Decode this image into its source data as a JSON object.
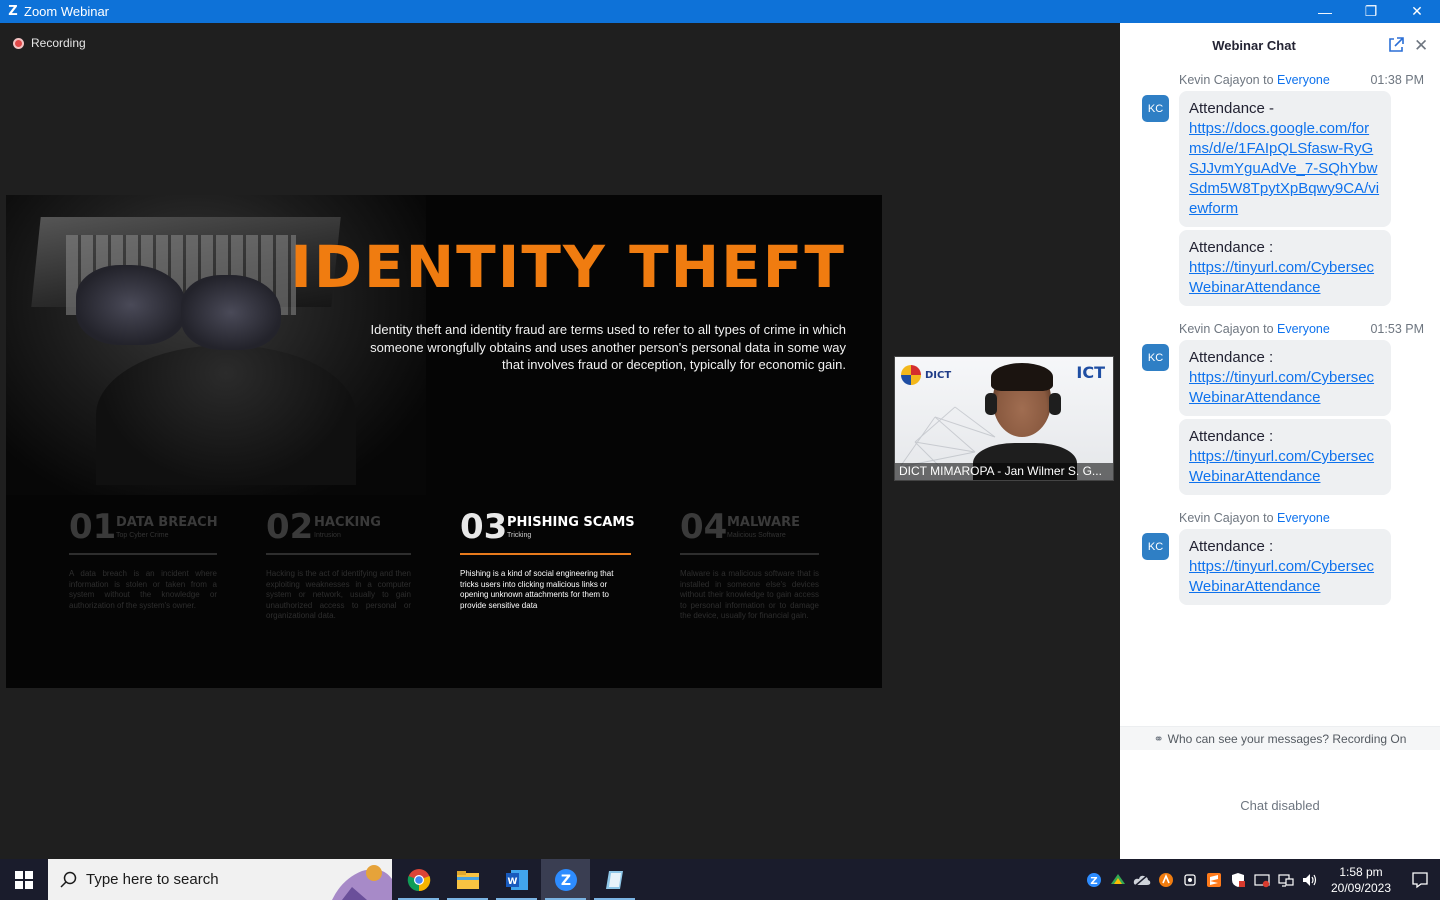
{
  "window": {
    "title": "Zoom Webinar",
    "minimize": "—",
    "restore": "❐",
    "close": "✕"
  },
  "stage": {
    "recording_label": "Recording"
  },
  "slide": {
    "heading": "IDENTITY THEFT",
    "description": "Identity theft and identity fraud are terms used to refer to all types of crime in which someone wrongfully obtains and uses another person's personal data in some way that involves fraud or deception, typically for economic gain.",
    "items": [
      {
        "num": "01",
        "name": "DATA BREACH",
        "sub": "Top Cyber Crime",
        "text": "A data breach is an incident where information is stolen or taken from a system without the knowledge or authorization of the system's owner."
      },
      {
        "num": "02",
        "name": "HACKING",
        "sub": "Intrusion",
        "text": "Hacking is the act of identifying and then exploiting weaknesses in a computer system or network, usually to gain unauthorized access to personal or organizational data."
      },
      {
        "num": "03",
        "name": "PHISHING SCAMS",
        "sub": "Tricking",
        "text": "Phishing is a kind of social engineering that tricks users into clicking malicious links or opening unknown attachments for them to provide sensitive data"
      },
      {
        "num": "04",
        "name": "MALWARE",
        "sub": "Malicious Software",
        "text": "Malware is a malicious software that is installed in someone else's devices without their knowledge to gain access to personal information or to damage the device, usually for financial gain."
      }
    ]
  },
  "video": {
    "name_label": "DICT MIMAROPA - Jan Wilmer S. G...",
    "logo_left": "DICT",
    "logo_right": "ICT"
  },
  "chat": {
    "title": "Webinar Chat",
    "messages": [
      {
        "sender": "Kevin Cajayon",
        "to_word": "to",
        "target": "Everyone",
        "time": "01:38 PM",
        "initials": "KC",
        "bubbles": [
          {
            "label": "Attendance -",
            "link": "https://docs.google.com/forms/d/e/1FAIpQLSfasw-RyGSJJvmYguAdVe_7-SQhYbwSdm5W8TpytXpBqwy9CA/viewform"
          },
          {
            "label": "Attendance :",
            "link": "https://tinyurl.com/CybersecWebinarAttendance"
          }
        ]
      },
      {
        "sender": "Kevin Cajayon",
        "to_word": "to",
        "target": "Everyone",
        "time": "01:53 PM",
        "initials": "KC",
        "bubbles": [
          {
            "label": "Attendance :",
            "link": "https://tinyurl.com/CybersecWebinarAttendance"
          },
          {
            "label": "Attendance :",
            "link": "https://tinyurl.com/CybersecWebinarAttendance"
          }
        ]
      },
      {
        "sender": "Kevin Cajayon",
        "to_word": "to",
        "target": "Everyone",
        "time": "",
        "initials": "KC",
        "bubbles": [
          {
            "label": "Attendance :",
            "link": "https://tinyurl.com/CybersecWebinarAttendance"
          }
        ]
      }
    ],
    "privacy_text": "Who can see your messages? Recording On",
    "disabled_text": "Chat disabled"
  },
  "taskbar": {
    "search_placeholder": "Type here to search",
    "time": "1:58 pm",
    "date": "20/09/2023",
    "apps": [
      "chrome-icon",
      "file-explorer-icon",
      "word-icon",
      "zoom-icon",
      "notepad-icon"
    ]
  },
  "colors": {
    "accent_orange": "#f07c10",
    "zoom_blue": "#0e72d8",
    "link_blue": "#0e72ed"
  }
}
